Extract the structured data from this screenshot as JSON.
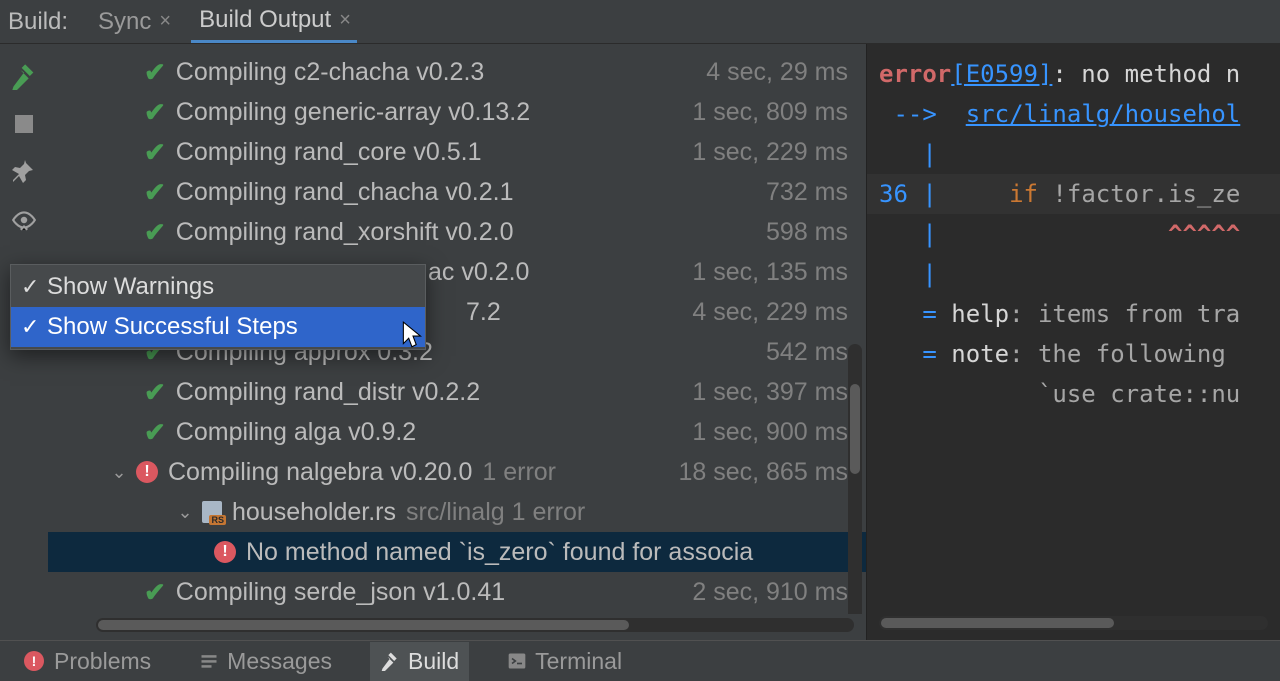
{
  "tabs": {
    "title": "Build:",
    "items": [
      {
        "label": "Sync",
        "active": false
      },
      {
        "label": "Build Output",
        "active": true
      }
    ]
  },
  "tree": [
    {
      "status": "ok",
      "label": "Compiling c2-chacha v0.2.3",
      "time": "4 sec, 29 ms"
    },
    {
      "status": "ok",
      "label": "Compiling generic-array v0.13.2",
      "time": "1 sec, 809 ms"
    },
    {
      "status": "ok",
      "label": "Compiling rand_core v0.5.1",
      "time": "1 sec, 229 ms"
    },
    {
      "status": "ok",
      "label": "Compiling rand_chacha v0.2.1",
      "time": "732 ms"
    },
    {
      "status": "ok",
      "label": "Compiling rand_xorshift v0.2.0",
      "time": "598 ms"
    },
    {
      "status": "ok",
      "label": "ac v0.2.0",
      "time": "1 sec, 135 ms",
      "truncatedLeft": true
    },
    {
      "status": "ok",
      "label": "7.2",
      "time": "4 sec, 229 ms",
      "truncatedLeft": true
    },
    {
      "status": "ok",
      "label": "Compiling approx    0.3.2",
      "time": "542 ms",
      "overlapped": true
    },
    {
      "status": "ok",
      "label": "Compiling rand_distr v0.2.2",
      "time": "1 sec, 397 ms"
    },
    {
      "status": "ok",
      "label": "Compiling alga v0.9.2",
      "time": "1 sec, 900 ms"
    },
    {
      "status": "err",
      "label": "Compiling nalgebra v0.20.0",
      "label2": "1 error",
      "time": "18 sec, 865 ms",
      "expandable": true,
      "expanded": true
    },
    {
      "status": "file",
      "label": "householder.rs",
      "label2": "src/linalg 1 error",
      "indent": 2,
      "expandable": true,
      "expanded": true
    },
    {
      "status": "err",
      "label": "No method named `is_zero` found for associa",
      "indent": 3,
      "selected": true
    },
    {
      "status": "ok",
      "label": "Compiling serde_json v1.0.41",
      "time": "2 sec, 910 ms"
    }
  ],
  "popup": {
    "items": [
      {
        "label": "Show Warnings",
        "checked": true,
        "hovered": false
      },
      {
        "label": "Show Successful Steps",
        "checked": true,
        "hovered": true
      }
    ]
  },
  "code": {
    "error_code": "[E0599]",
    "error_msg": ": no method n",
    "arrow": "-->",
    "src_path": "src/linalg/househol",
    "pipe": "|",
    "line_no": "36",
    "code_frag_if": "if ",
    "code_frag_rest": "!factor.is_ze",
    "carets": "^^^^^",
    "eq": "=",
    "help_kw": "help",
    "help_txt": ": items from tra",
    "note_kw": "note",
    "note_txt": ": the following ",
    "use_txt": "`use crate::nu"
  },
  "bottom": {
    "problems": "Problems",
    "messages": "Messages",
    "build": "Build",
    "terminal": "Terminal"
  }
}
